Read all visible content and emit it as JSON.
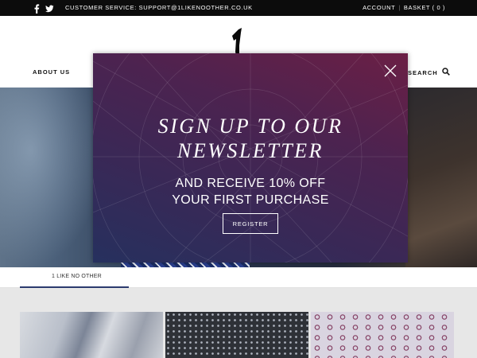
{
  "topbar": {
    "service_text": "CUSTOMER SERVICE: SUPPORT@1LIKENOOTHER.CO.UK",
    "account_label": "ACCOUNT",
    "separator": "|",
    "basket_label": "BASKET ( 0 )"
  },
  "social": [
    "facebook-icon",
    "twitter-icon"
  ],
  "header": {
    "logo": "1-logo",
    "nav_about": "ABOUT US",
    "nav_search": "SEARCH"
  },
  "modal": {
    "title_line1": "SIGN UP TO OUR",
    "title_line2": "NEWSLETTER",
    "offer_line1": "AND RECEIVE 10% OFF",
    "offer_line2": "YOUR FIRST PURCHASE",
    "register_label": "REGISTER",
    "close_icon": "close-icon"
  },
  "tabs": {
    "active_label": "1 LIKE NO OTHER"
  },
  "colors": {
    "topbar_bg": "#0c0c0c",
    "modal_top": "#6b1f45",
    "modal_bottom": "#26305e",
    "tab_underline": "#2c3b6e"
  }
}
